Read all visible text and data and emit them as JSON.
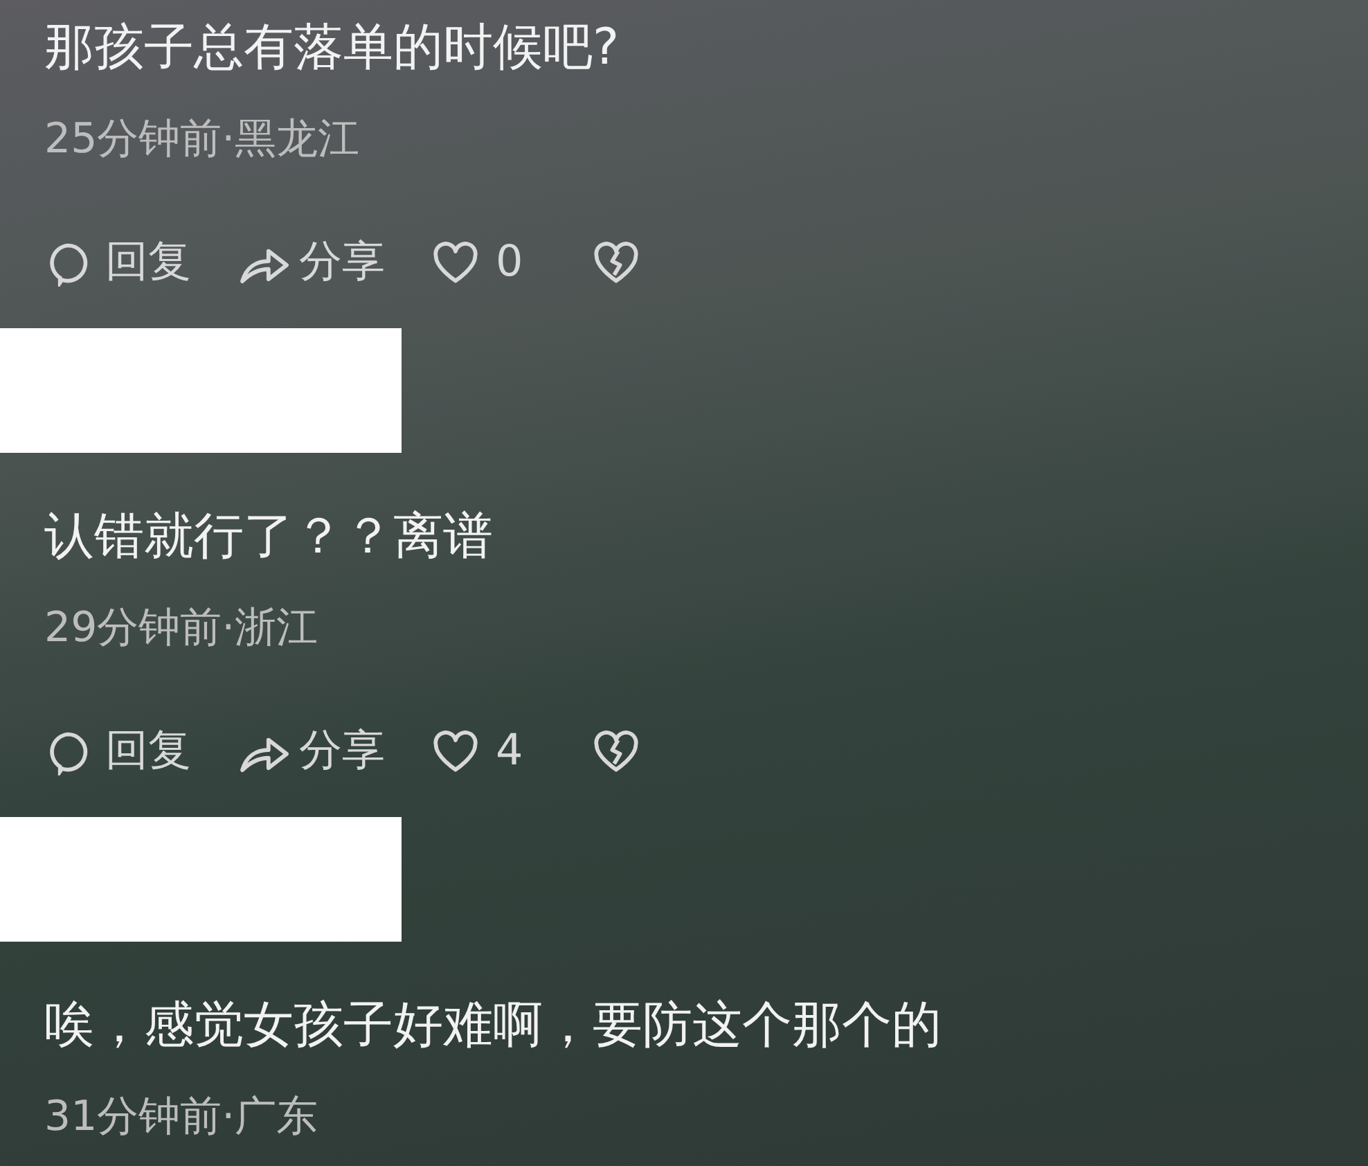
{
  "items": [
    {
      "kind": "comment",
      "text": "那孩子总有落单的时候吧?",
      "meta": "25分钟前·黑龙江",
      "actions": {
        "reply": "回复",
        "share": "分享",
        "likes": "0"
      }
    },
    {
      "kind": "redaction"
    },
    {
      "kind": "comment",
      "text": "认错就行了？？离谱",
      "meta": "29分钟前·浙江",
      "actions": {
        "reply": "回复",
        "share": "分享",
        "likes": "4"
      }
    },
    {
      "kind": "redaction"
    },
    {
      "kind": "comment",
      "text": "唉，感觉女孩子好难啊，要防这个那个的",
      "meta": "31分钟前·广东"
    }
  ]
}
